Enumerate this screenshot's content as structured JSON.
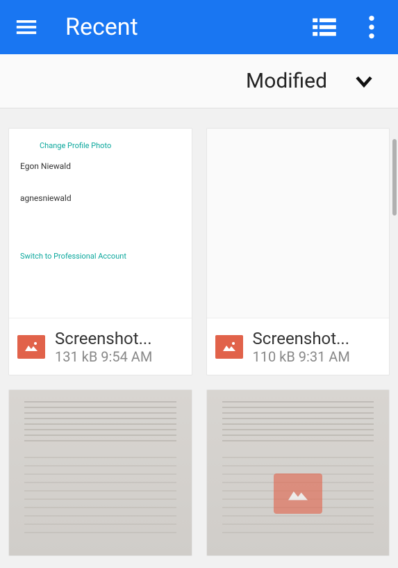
{
  "header": {
    "title": "Recent"
  },
  "sort": {
    "label": "Modified"
  },
  "thumb1": {
    "line1": "Change Profile Photo",
    "name1": "Egon Niewald",
    "name2": "agnesniewald",
    "switch": "Switch to Professional Account"
  },
  "files": [
    {
      "name": "Screenshot...",
      "size": "131 kB",
      "time": "9:54 AM"
    },
    {
      "name": "Screenshot...",
      "size": "110 kB",
      "time": "9:31 AM"
    }
  ]
}
